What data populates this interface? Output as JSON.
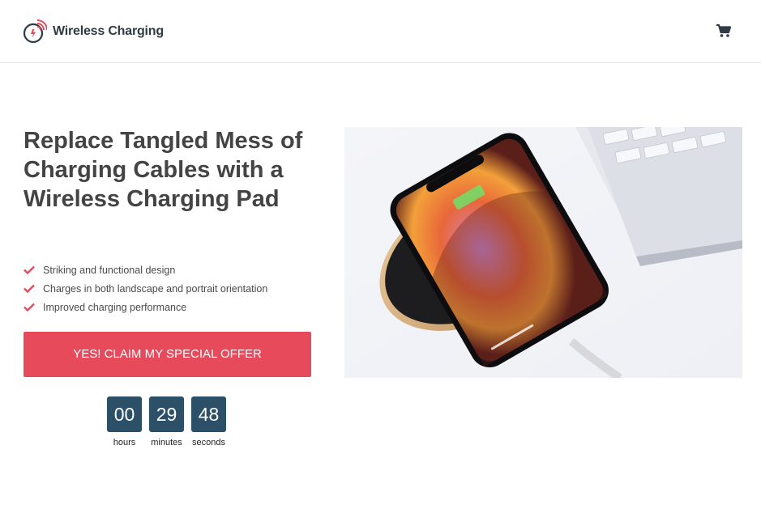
{
  "header": {
    "brand": "Wireless Charging",
    "logo_icon": "wireless-charging-logo-icon",
    "cart_icon": "shopping-cart-icon"
  },
  "hero": {
    "headline": "Replace Tangled Mess of Charging Cables with a Wireless Charging Pad",
    "features": [
      "Striking and functional design",
      "Charges in both landscape and portrait orientation",
      "Improved charging performance"
    ],
    "cta_label": "YES! CLAIM MY SPECIAL OFFER",
    "image_alt": "Smartphone on round wireless charging pad next to laptop"
  },
  "countdown": {
    "hours": "00",
    "minutes": "29",
    "seconds": "48",
    "hours_label": "hours",
    "minutes_label": "minutes",
    "seconds_label": "seconds"
  },
  "colors": {
    "accent": "#e74a5b",
    "countdown_box": "#2b5068",
    "heading": "#444444",
    "check": "#e74a5b"
  }
}
